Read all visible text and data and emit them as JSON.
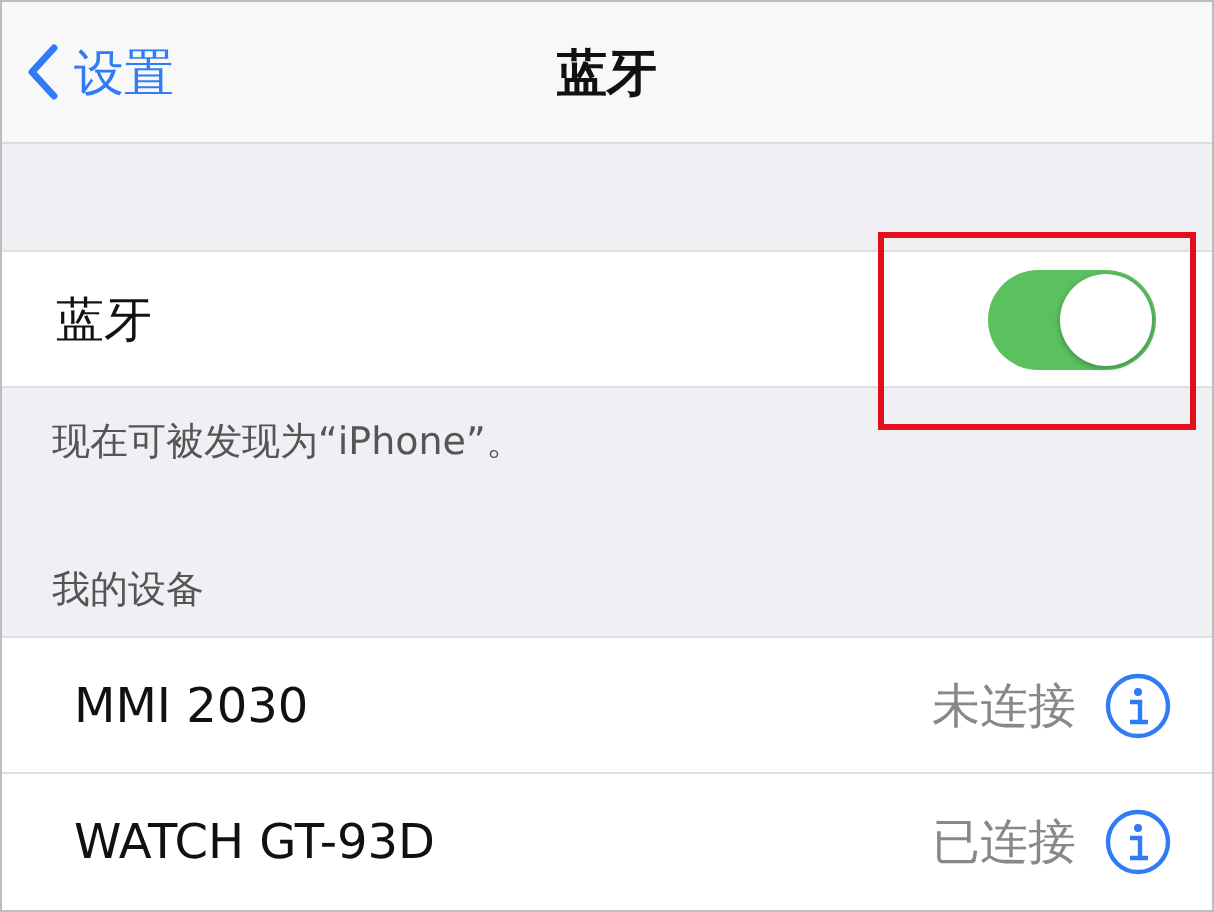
{
  "nav": {
    "back": "设置",
    "title": "蓝牙"
  },
  "bluetooth": {
    "label": "蓝牙",
    "on": true,
    "highlighted": true
  },
  "discoverable_note": "现在可被发现为“iPhone”。",
  "section_header": "我的设备",
  "devices": [
    {
      "name": "MMI 2030",
      "status": "未连接"
    },
    {
      "name": "WATCH GT-93D",
      "status": "已连接"
    }
  ]
}
